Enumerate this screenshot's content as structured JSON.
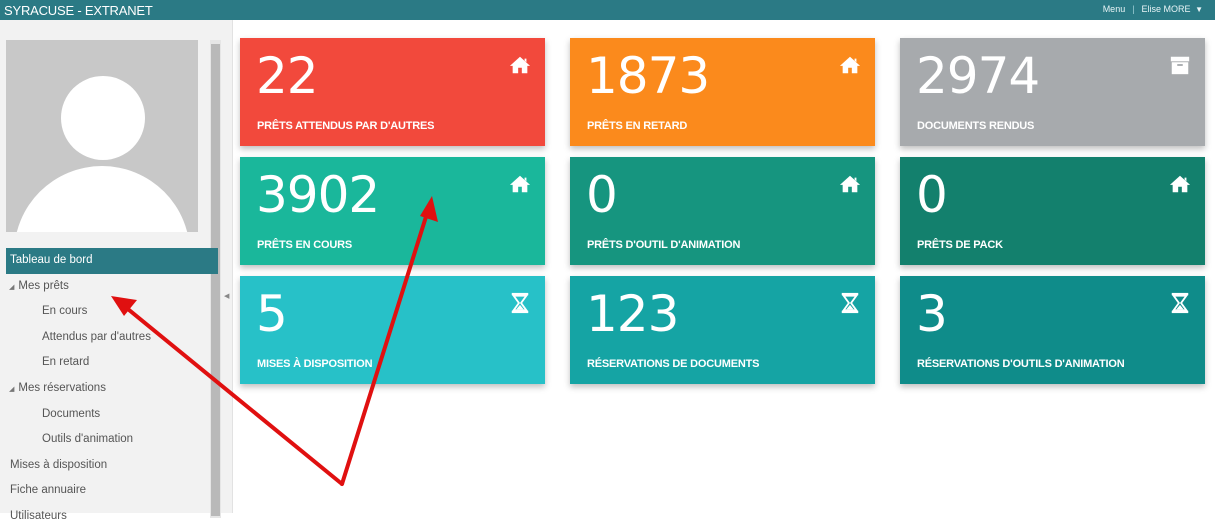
{
  "app": {
    "title": "SYRACUSE - EXTRANET",
    "menu_label": "Menu",
    "user_name": "Elise MORE"
  },
  "sidebar": {
    "items": [
      {
        "label": "Tableau de bord",
        "active": true,
        "level": 0
      },
      {
        "label": "Mes prêts",
        "level": 1,
        "expanded": true
      },
      {
        "label": "En cours",
        "level": 2
      },
      {
        "label": "Attendus par d'autres",
        "level": 2
      },
      {
        "label": "En retard",
        "level": 2
      },
      {
        "label": "Mes réservations",
        "level": 1,
        "expanded": true
      },
      {
        "label": "Documents",
        "level": 2
      },
      {
        "label": "Outils d'animation",
        "level": 2
      },
      {
        "label": "Mises à disposition",
        "level": 0
      },
      {
        "label": "Fiche annuaire",
        "level": 0
      },
      {
        "label": "Utilisateurs",
        "level": 0
      }
    ]
  },
  "tiles": [
    {
      "count": "22",
      "label": "PRÊTS ATTENDUS PAR D'AUTRES",
      "icon": "home-icon",
      "color": "#f2493c"
    },
    {
      "count": "1873",
      "label": "PRÊTS EN RETARD",
      "icon": "home-icon",
      "color": "#fb8a1c"
    },
    {
      "count": "2974",
      "label": "DOCUMENTS RENDUS",
      "icon": "archive-box-icon",
      "color": "#a7aaad"
    },
    {
      "count": "3902",
      "label": "PRÊTS EN COURS",
      "icon": "home-icon",
      "color": "#1ab79b"
    },
    {
      "count": "0",
      "label": "PRÊTS D'OUTIL D'ANIMATION",
      "icon": "home-icon",
      "color": "#16957f"
    },
    {
      "count": "0",
      "label": "PRÊTS DE PACK",
      "icon": "home-icon",
      "color": "#13806d"
    },
    {
      "count": "5",
      "label": "MISES À DISPOSITION",
      "icon": "hourglass-icon",
      "color": "#27c1c8"
    },
    {
      "count": "123",
      "label": "RÉSERVATIONS DE DOCUMENTS",
      "icon": "hourglass-icon",
      "color": "#15a4a4"
    },
    {
      "count": "3",
      "label": "RÉSERVATIONS D'OUTILS D'ANIMATION",
      "icon": "hourglass-icon",
      "color": "#0f8c8a"
    }
  ],
  "colors": {
    "topbar": "#2b7a85",
    "annotation_arrow": "#e01010"
  }
}
